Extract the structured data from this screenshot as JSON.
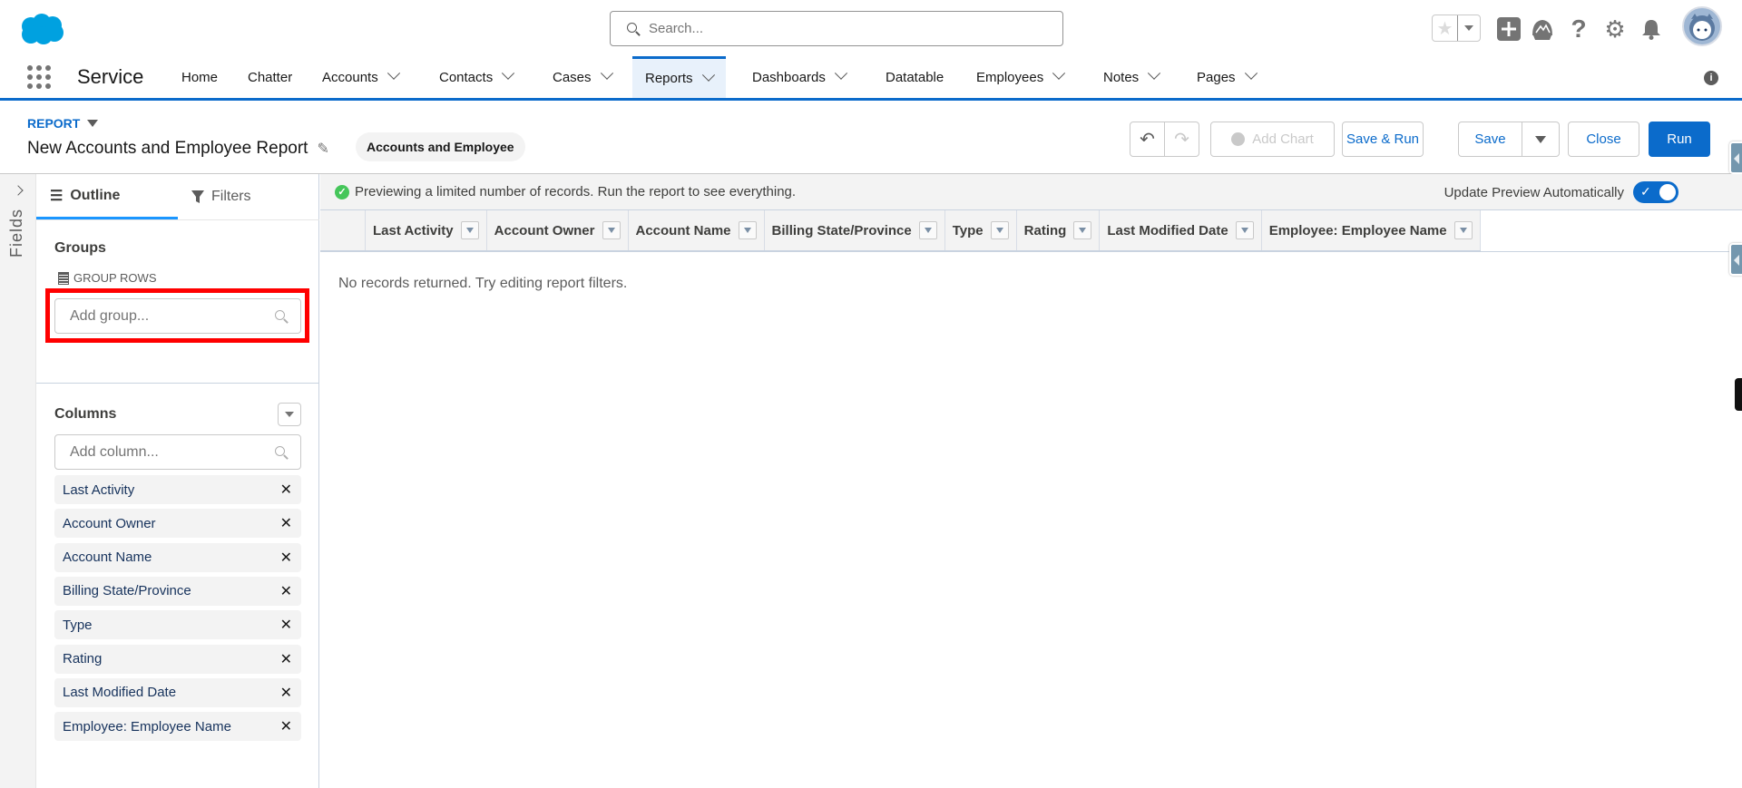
{
  "header": {
    "search_placeholder": "Search...",
    "icons": [
      "salesforce-logo",
      "search-icon",
      "favorite-star-icon",
      "chevron-down-icon",
      "global-actions-plus-icon",
      "trailhead-icon",
      "help-icon",
      "setup-gear-icon",
      "notifications-bell-icon",
      "user-avatar"
    ]
  },
  "nav": {
    "app_name": "Service",
    "items": [
      {
        "label": "Home",
        "dropdown": false
      },
      {
        "label": "Chatter",
        "dropdown": false
      },
      {
        "label": "Accounts",
        "dropdown": true
      },
      {
        "label": "Contacts",
        "dropdown": true
      },
      {
        "label": "Cases",
        "dropdown": true
      },
      {
        "label": "Reports",
        "dropdown": true,
        "active": true
      },
      {
        "label": "Dashboards",
        "dropdown": true
      },
      {
        "label": "Datatable",
        "dropdown": false
      },
      {
        "label": "Employees",
        "dropdown": true
      },
      {
        "label": "Notes",
        "dropdown": true
      },
      {
        "label": "Pages",
        "dropdown": true
      }
    ],
    "info_glyph": "i"
  },
  "report": {
    "label": "REPORT",
    "title": "New Accounts and Employee Report",
    "report_type": "Accounts and Employee",
    "buttons": {
      "undo": "↶",
      "redo": "↷",
      "add_chart": "Add Chart",
      "save_run": "Save & Run",
      "save": "Save",
      "close": "Close",
      "run": "Run"
    }
  },
  "sidebar": {
    "fields_label": "Fields",
    "tabs": {
      "outline": "Outline",
      "filters": "Filters"
    },
    "groups": {
      "title": "Groups",
      "group_rows_label": "GROUP ROWS",
      "add_group_placeholder": "Add group..."
    },
    "columns": {
      "title": "Columns",
      "add_column_placeholder": "Add column...",
      "items": [
        "Last Activity",
        "Account Owner",
        "Account Name",
        "Billing State/Province",
        "Type",
        "Rating",
        "Last Modified Date",
        "Employee: Employee Name"
      ],
      "remove_glyph": "✕"
    }
  },
  "preview": {
    "message": "Previewing a limited number of records. Run the report to see everything.",
    "auto_update_label": "Update Preview Automatically",
    "auto_update_on": true,
    "table_headers": [
      "Last Activity",
      "Account Owner",
      "Account Name",
      "Billing State/Province",
      "Type",
      "Rating",
      "Last Modified Date",
      "Employee: Employee Name"
    ],
    "empty_message": "No records returned. Try editing report filters."
  },
  "colors": {
    "brand": "#0b6bcb",
    "highlight_box": "#ff0000",
    "success": "#45c65a",
    "logo": "#00a1e0"
  }
}
